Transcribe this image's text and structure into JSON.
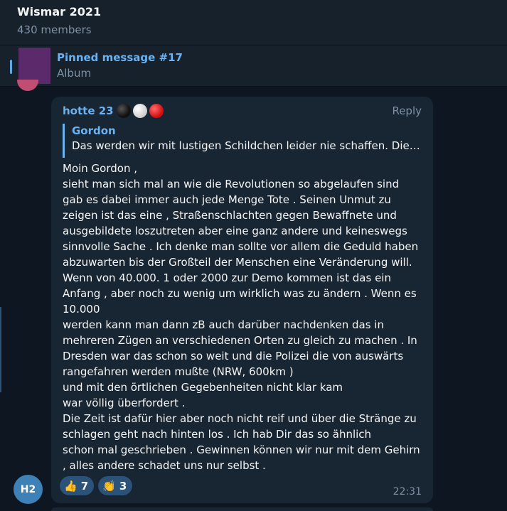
{
  "chat": {
    "title": "Wismar 2021",
    "members": "430 members"
  },
  "pinned": {
    "title": "Pinned message #17",
    "subtitle": "Album"
  },
  "message": {
    "sender": "hotte 23",
    "sender_emoji": [
      "black-circle",
      "white-circle",
      "red-circle"
    ],
    "reply_label": "Reply",
    "quote": {
      "name": "Gordon",
      "text": "Das werden wir mit lustigen Schildchen leider nie schaffen. Die ..."
    },
    "lines": [
      "Moin Gordon ,",
      "sieht man sich mal an wie die Revolutionen so abgelaufen sind",
      "gab es dabei immer auch jede Menge Tote . Seinen Unmut zu",
      "zeigen ist das eine ,  Straßenschlachten gegen Bewaffnete und",
      "ausgebildete loszutreten aber eine ganz andere und keineswegs",
      "sinnvolle Sache . Ich denke man sollte vor allem die Geduld haben",
      "abzuwarten bis der Großteil der Menschen eine Veränderung will.",
      "Wenn von 40.000.   1 oder 2000 zur Demo kommen ist das ein",
      "Anfang , aber noch zu wenig um wirklich was zu ändern . Wenn es",
      "10.000",
      "werden kann man dann zB auch darüber nachdenken das in",
      "mehreren Zügen an verschiedenen Orten zu gleich zu machen . In",
      "Dresden war das schon so weit und die Polizei die von auswärts",
      "rangefahren werden mußte (NRW, 600km )",
      "und mit den örtlichen Gegebenheiten nicht klar kam",
      "war völlig überfordert .",
      "Die Zeit ist dafür hier aber noch nicht reif und über die Stränge zu",
      "schlagen geht nach hinten los . Ich hab Dir das so ähnlich",
      "schon mal geschrieben . Gewinnen können wir nur mit dem Gehirn",
      ", alles andere schadet uns nur selbst ."
    ],
    "reactions": [
      {
        "emoji": "👍",
        "icon": "thumbs-up-icon",
        "count": "7"
      },
      {
        "emoji": "👏",
        "icon": "clapping-hands-icon",
        "count": "3"
      }
    ],
    "time": "22:31",
    "avatar_initials": "H2"
  },
  "colors": {
    "background": "#0e1621",
    "panel": "#17212b",
    "bubble": "#182533",
    "accent": "#6ab2f2",
    "muted": "#7f91a4",
    "reaction_bg": "#2b5278",
    "avatar": "#3e81b6"
  }
}
